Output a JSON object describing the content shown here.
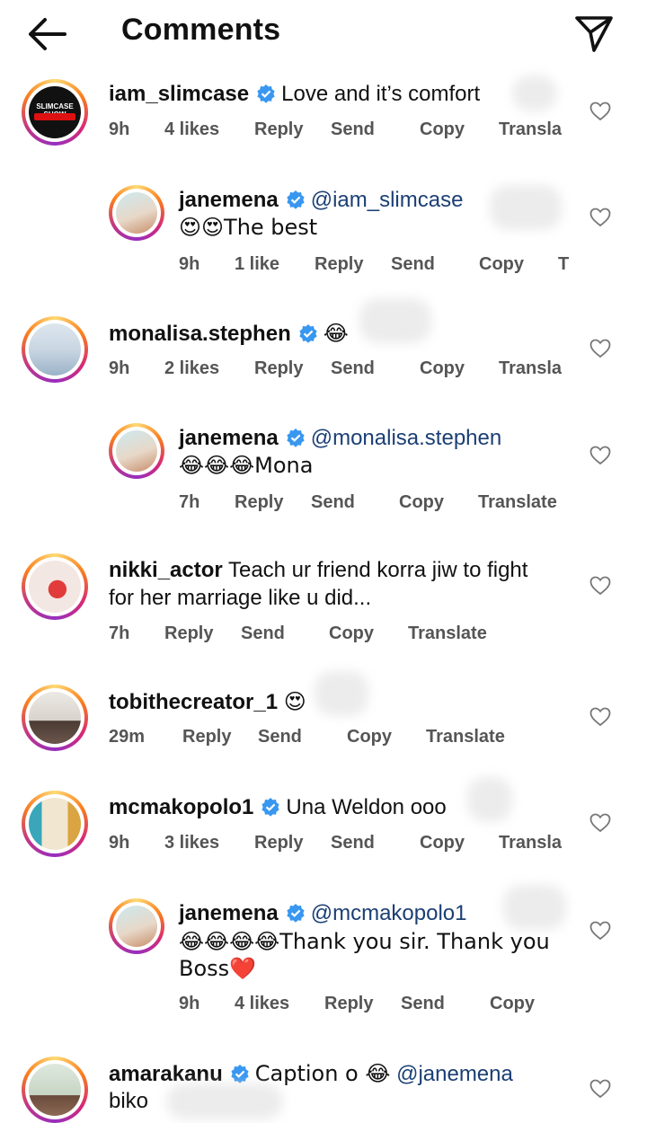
{
  "header": {
    "title": "Comments"
  },
  "comments": [
    {
      "user": "iam_slimcase",
      "verified": true,
      "text": "Love and it’s comfort",
      "time": "9h",
      "likes": "4 likes",
      "reply": "Reply",
      "send": "Send",
      "copy": "Copy",
      "translate": "Transla",
      "avatar_text": "SLIMCASE SHOW"
    },
    {
      "user": "janemena",
      "verified": true,
      "mention": "@iam_slimcase",
      "text": "😍😍The best",
      "time": "9h",
      "likes": "1 like",
      "reply": "Reply",
      "send": "Send",
      "copy": "Copy",
      "translate": "T"
    },
    {
      "user": "monalisa.stephen",
      "verified": true,
      "text": "😂",
      "time": "9h",
      "likes": "2 likes",
      "reply": "Reply",
      "send": "Send",
      "copy": "Copy",
      "translate": "Transla"
    },
    {
      "user": "janemena",
      "verified": true,
      "mention": "@monalisa.stephen",
      "text": "😂😂😂Mona",
      "time": "7h",
      "reply": "Reply",
      "send": "Send",
      "copy": "Copy",
      "translate": "Translate"
    },
    {
      "user": "nikki_actor",
      "text": "Teach ur friend korra jiw to fight",
      "text2": "for her marriage like u did...",
      "time": "7h",
      "reply": "Reply",
      "send": "Send",
      "copy": "Copy",
      "translate": "Translate"
    },
    {
      "user": "tobithecreator_1",
      "text": "😍",
      "time": "29m",
      "reply": "Reply",
      "send": "Send",
      "copy": "Copy",
      "translate": "Translate"
    },
    {
      "user": "mcmakopolo1",
      "verified": true,
      "text": "Una Weldon ooo",
      "time": "9h",
      "likes": "3 likes",
      "reply": "Reply",
      "send": "Send",
      "copy": "Copy",
      "translate": "Transla"
    },
    {
      "user": "janemena",
      "verified": true,
      "mention": "@mcmakopolo1",
      "text": "😂😂😂😂Thank you sir. Thank you",
      "text2": "Boss❤️",
      "time": "9h",
      "likes": "4 likes",
      "reply": "Reply",
      "send": "Send",
      "copy": "Copy"
    },
    {
      "user": "amarakanu",
      "verified": true,
      "text": "Caption o 😂",
      "mention": "@janemena",
      "text2": "biko"
    }
  ],
  "colors": {
    "verified": "#3897f0",
    "mention": "#1b3f74",
    "meta": "#555555"
  }
}
